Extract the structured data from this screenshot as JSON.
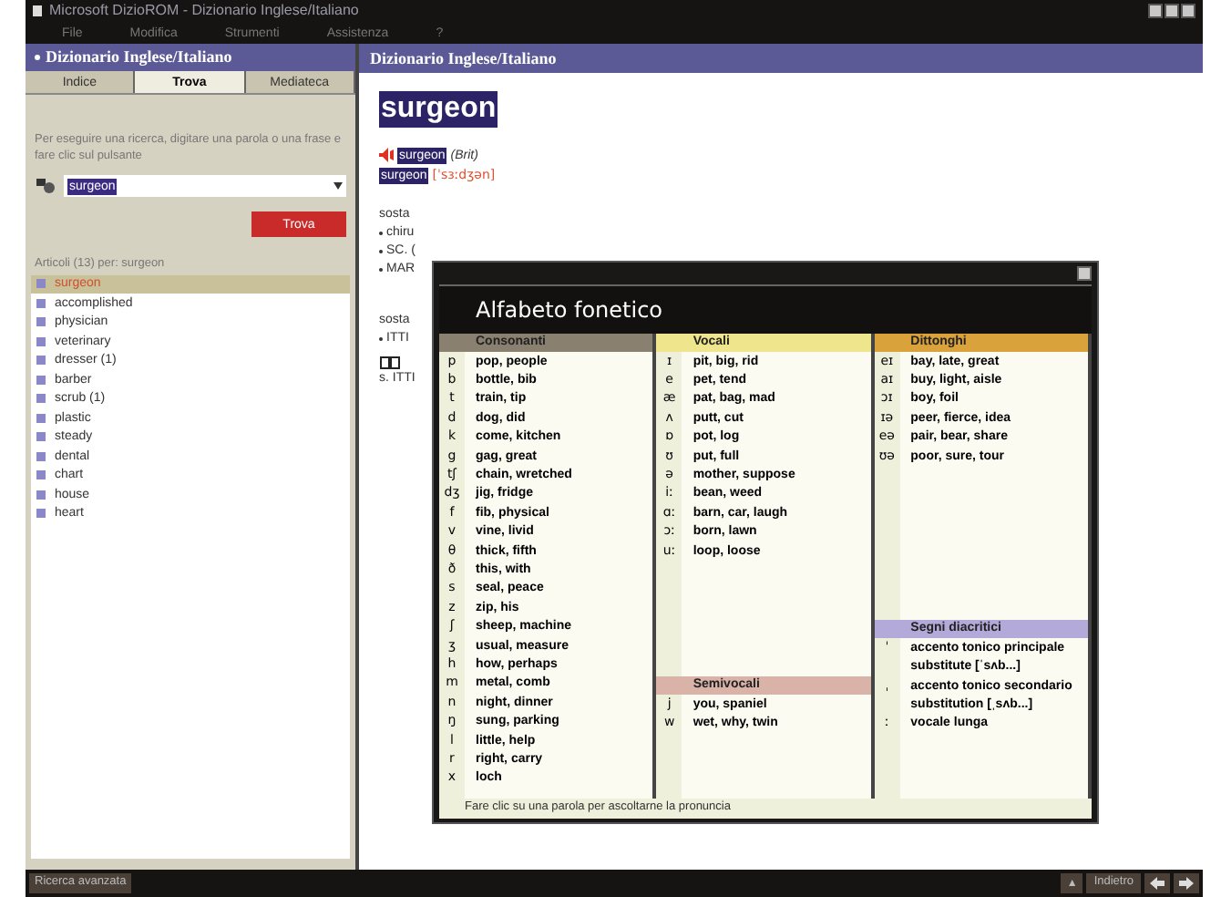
{
  "window": {
    "title": "Microsoft DizioROM - Dizionario Inglese/Italiano"
  },
  "menu": [
    "File",
    "Modifica",
    "Strumenti",
    "Assistenza",
    "?"
  ],
  "left_panel": {
    "header": "Dizionario Inglese/Italiano",
    "tabs": [
      {
        "label": "Indice",
        "selected": false
      },
      {
        "label": "Trova",
        "selected": true
      },
      {
        "label": "Mediateca",
        "selected": false
      }
    ],
    "instructions": "Per eseguire una ricerca, digitare una parola o una frase e fare clic sul pulsante",
    "search": {
      "value": "surgeon"
    },
    "find_button": "Trova",
    "results_label": "Articoli (13) per: surgeon",
    "results": [
      {
        "label": "surgeon",
        "selected": true
      },
      {
        "label": "accomplished",
        "selected": false
      },
      {
        "label": "physician",
        "selected": false
      },
      {
        "label": "veterinary",
        "selected": false
      },
      {
        "label": "dresser (1)",
        "selected": false
      },
      {
        "label": "barber",
        "selected": false
      },
      {
        "label": "scrub (1)",
        "selected": false
      },
      {
        "label": "plastic",
        "selected": false
      },
      {
        "label": "steady",
        "selected": false
      },
      {
        "label": "dental",
        "selected": false
      },
      {
        "label": "chart",
        "selected": false
      },
      {
        "label": "house",
        "selected": false
      },
      {
        "label": "heart",
        "selected": false
      }
    ]
  },
  "content": {
    "header": "Dizionario Inglese/Italiano",
    "headword": "surgeon",
    "variants": [
      {
        "kind": "region",
        "audio": true,
        "word": "surgeon",
        "note": "(Brit)"
      },
      {
        "kind": "pron",
        "audio": false,
        "word": "surgeon",
        "note": "[ˈsɜːdʒən]"
      }
    ],
    "lines": [
      {
        "kind": "pos",
        "text": "sosta"
      },
      {
        "kind": "bullet",
        "text": "chiru"
      },
      {
        "kind": "bullet",
        "text": "SC. ("
      },
      {
        "kind": "bullet",
        "text": "MAR"
      },
      {
        "kind": "gap"
      },
      {
        "kind": "pos",
        "text": "sosta"
      },
      {
        "kind": "bullet",
        "text": "ITTI"
      },
      {
        "kind": "book"
      },
      {
        "kind": "ref",
        "text": "s. ITTI"
      }
    ]
  },
  "phonetic_dialog": {
    "title": "Alfabeto fonetico",
    "columns": [
      {
        "sections": [
          {
            "heading": "Consonanti",
            "color": "#8a8070",
            "entries": [
              {
                "symbol": "p",
                "example": "pop, people"
              },
              {
                "symbol": "b",
                "example": "bottle, bib"
              },
              {
                "symbol": "t",
                "example": "train, tip"
              },
              {
                "symbol": "d",
                "example": "dog, did"
              },
              {
                "symbol": "k",
                "example": "come, kitchen"
              },
              {
                "symbol": "g",
                "example": "gag, great"
              },
              {
                "symbol": "tʃ",
                "example": "chain, wretched"
              },
              {
                "symbol": "dʒ",
                "example": "jig, fridge"
              },
              {
                "symbol": "f",
                "example": "fib, physical"
              },
              {
                "symbol": "v",
                "example": "vine, livid"
              },
              {
                "symbol": "θ",
                "example": "thick, fifth"
              },
              {
                "symbol": "ð",
                "example": "this, with"
              },
              {
                "symbol": "s",
                "example": "seal, peace"
              },
              {
                "symbol": "z",
                "example": "zip, his"
              },
              {
                "symbol": "ʃ",
                "example": "sheep, machine"
              },
              {
                "symbol": "ʒ",
                "example": "usual, measure"
              },
              {
                "symbol": "h",
                "example": "how, perhaps"
              },
              {
                "symbol": "m",
                "example": "metal, comb"
              },
              {
                "symbol": "n",
                "example": "night, dinner"
              },
              {
                "symbol": "ŋ",
                "example": "sung, parking"
              },
              {
                "symbol": "l",
                "example": "little, help"
              },
              {
                "symbol": "r",
                "example": "right, carry"
              },
              {
                "symbol": "x",
                "example": "loch"
              }
            ]
          }
        ]
      },
      {
        "sections": [
          {
            "heading": "Vocali",
            "color": "#efe58c",
            "entries": [
              {
                "symbol": "ɪ",
                "example": "pit, big, rid"
              },
              {
                "symbol": "e",
                "example": "pet, tend"
              },
              {
                "symbol": "æ",
                "example": "pat, bag, mad"
              },
              {
                "symbol": "ʌ",
                "example": "putt, cut"
              },
              {
                "symbol": "ɒ",
                "example": "pot, log"
              },
              {
                "symbol": "ʊ",
                "example": "put, full"
              },
              {
                "symbol": "ə",
                "example": "mother, suppose"
              },
              {
                "symbol": "iː",
                "example": "bean, weed"
              },
              {
                "symbol": "ɑː",
                "example": "barn, car, laugh"
              },
              {
                "symbol": "ɔː",
                "example": "born, lawn"
              },
              {
                "symbol": "uː",
                "example": "loop, loose"
              }
            ]
          },
          {
            "heading": "Semivocali",
            "color": "#d9b2a8",
            "entries": [
              {
                "symbol": "j",
                "example": "you, spaniel"
              },
              {
                "symbol": "w",
                "example": "wet, why, twin"
              }
            ]
          }
        ]
      },
      {
        "sections": [
          {
            "heading": "Dittonghi",
            "color": "#d9a23a",
            "entries": [
              {
                "symbol": "eɪ",
                "example": "bay, late, great"
              },
              {
                "symbol": "aɪ",
                "example": "buy, light, aisle"
              },
              {
                "symbol": "ɔɪ",
                "example": "boy, foil"
              },
              {
                "symbol": "ɪə",
                "example": "peer, fierce, idea"
              },
              {
                "symbol": "eə",
                "example": "pair, bear, share"
              },
              {
                "symbol": "ʊə",
                "example": "poor, sure, tour"
              }
            ]
          },
          {
            "heading": "Segni diacritici",
            "color": "#b3aad9",
            "entries": [
              {
                "symbol": "ˈ",
                "example": "accento tonico principale"
              },
              {
                "example": "substitute [ˈsʌb...]"
              },
              {
                "symbol": "ˌ",
                "example": "accento tonico secondario"
              },
              {
                "example": "substitution [ˌsʌb...]"
              },
              {
                "symbol": "ː",
                "example": "vocale lunga"
              }
            ]
          }
        ]
      }
    ],
    "footer": "Fare clic su una parola per ascoltarne la pronuncia"
  },
  "status_bar": {
    "left_button": "Ricerca avanzata",
    "up_symbol": "▲",
    "back_button": "Indietro"
  }
}
